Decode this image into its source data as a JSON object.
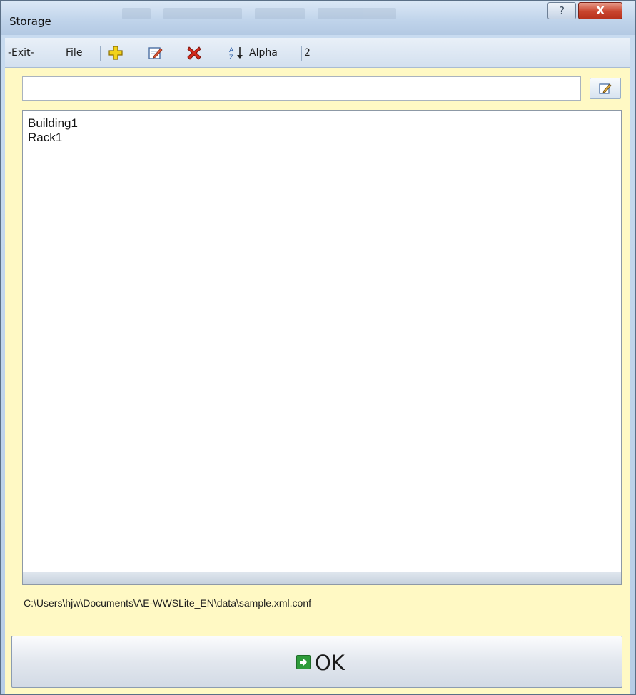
{
  "window": {
    "title": "Storage",
    "help_label": "?",
    "close_label": "X"
  },
  "menubar": {
    "exit_label": "-Exit-",
    "file_label": "File",
    "sort_label": "Alpha",
    "count": "2",
    "icons": [
      "add-icon",
      "edit-icon",
      "delete-icon",
      "sort-az-icon"
    ]
  },
  "search": {
    "value": ""
  },
  "list": {
    "items": [
      "Building1",
      "Rack1"
    ]
  },
  "status": {
    "path": "C:\\Users\\hjw\\Documents\\AE-WWSLite_EN\\data\\sample.xml.conf"
  },
  "ok_button": {
    "label": "OK"
  },
  "colors": {
    "client_background": "#fff9c4",
    "close_button": "#c9452e",
    "add_icon": "#f2d21a",
    "delete_icon": "#d42a1c",
    "ok_icon": "#2e9b3a"
  }
}
